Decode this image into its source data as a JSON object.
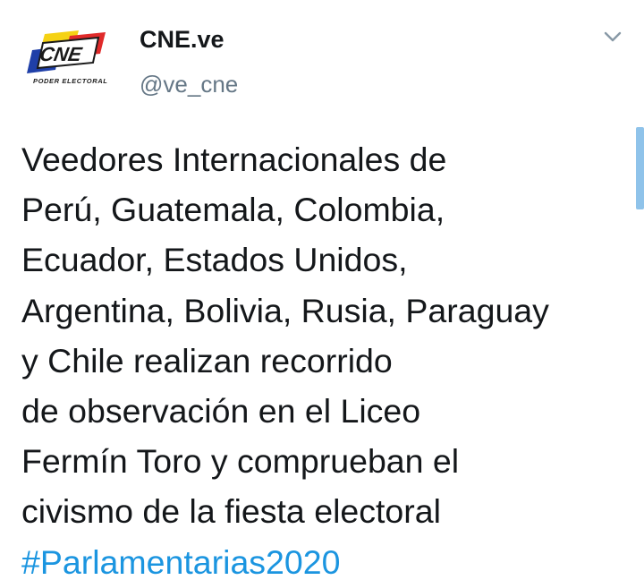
{
  "account": {
    "display_name": "CNE.ve",
    "handle": "@ve_cne",
    "avatar_logo_text": "CNE",
    "avatar_caption": "PODER ELECTORAL"
  },
  "tweet": {
    "lines": [
      "Veedores Internacionales de",
      "Perú, Guatemala, Colombia,",
      "Ecuador, Estados Unidos,",
      "Argentina, Bolivia, Rusia, Paraguay",
      "y Chile realizan recorrido",
      "de observación en el Liceo",
      "Fermín Toro y comprueban el",
      "civismo de la fiesta electoral"
    ],
    "hashtag": "#Parlamentarias2020"
  },
  "icons": {
    "menu": "chevron-down-icon",
    "avatar": "cne-logo"
  },
  "colors": {
    "text": "#14171a",
    "secondary": "#657786",
    "link": "#1b95e0",
    "logo_red": "#e02a2a",
    "logo_yellow": "#f5d214",
    "logo_blue": "#1f3fa8"
  }
}
